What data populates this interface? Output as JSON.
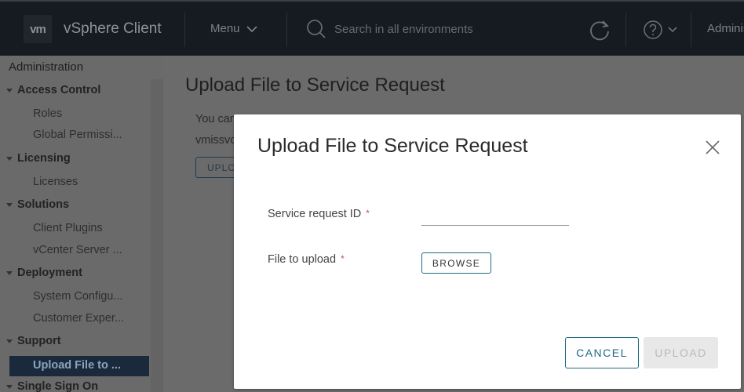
{
  "header": {
    "logo_text": "vm",
    "app_title": "vSphere Client",
    "menu_label": "Menu",
    "search_placeholder": "Search in all environments",
    "user_label": "Administrator"
  },
  "sidebar": {
    "title": "Administration",
    "groups": [
      {
        "label": "Access Control",
        "children": [
          "Roles",
          "Global Permissi..."
        ]
      },
      {
        "label": "Licensing",
        "children": [
          "Licenses"
        ]
      },
      {
        "label": "Solutions",
        "children": [
          "Client Plugins",
          "vCenter Server ..."
        ]
      },
      {
        "label": "Deployment",
        "children": [
          "System Configu...",
          "Customer Exper..."
        ]
      },
      {
        "label": "Support",
        "children": [
          "Upload File to ..."
        ]
      },
      {
        "label": "Single Sign On",
        "children": []
      }
    ],
    "active_item": "Upload File to ..."
  },
  "page": {
    "title": "Upload File to Service Request",
    "desc_line1": "You can",
    "desc_line2": "vmissvc",
    "upload_button": "UPLOAD"
  },
  "modal": {
    "title": "Upload File to Service Request",
    "service_request_label": "Service request ID",
    "service_request_value": "",
    "file_label": "File to upload",
    "required_marker": "*",
    "browse_label": "BROWSE",
    "cancel_label": "CANCEL",
    "upload_label": "UPLOAD",
    "upload_enabled": false
  },
  "colors": {
    "header_bg": "#161b21",
    "overlay_bg": "#6b6b6b",
    "accent": "#1e6b80",
    "active_item_bg": "#1a2a3c",
    "required": "#c25450"
  }
}
